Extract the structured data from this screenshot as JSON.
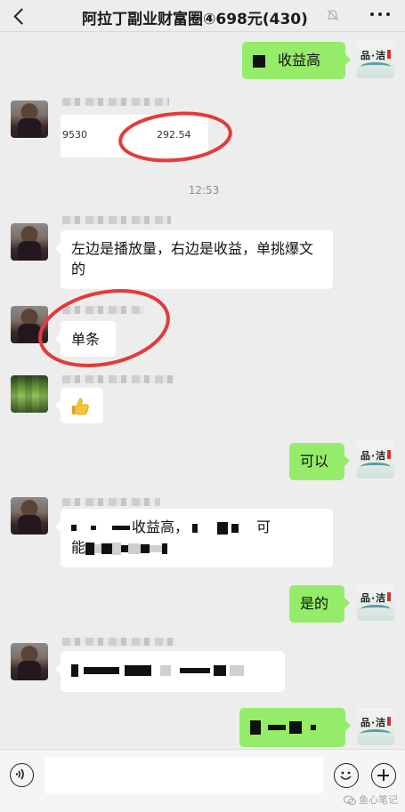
{
  "header": {
    "title": "阿拉丁副业财富圈④698元(430)",
    "back_icon": "chevron-left-icon",
    "mute_icon": "bell-off-icon",
    "more_icon": "more-dots-icon"
  },
  "timestamp": "12:53",
  "messages": [
    {
      "side": "out",
      "text": "收益高"
    },
    {
      "side": "in",
      "type": "image",
      "values": [
        "9530",
        "292.54"
      ]
    },
    {
      "side": "in",
      "text": "左边是播放量，右边是收益，单挑爆文的"
    },
    {
      "side": "in",
      "text": "单条"
    },
    {
      "side": "in",
      "type": "emoji",
      "icon": "thumbs-up-icon"
    },
    {
      "side": "out",
      "text": "可以"
    },
    {
      "side": "in",
      "text_fragments": [
        "收益高，",
        "可",
        "能"
      ]
    },
    {
      "side": "out",
      "text": "是的"
    },
    {
      "side": "in",
      "text": "(pixelated)"
    },
    {
      "side": "out",
      "text": "(pixelated)"
    }
  ],
  "input_bar": {
    "placeholder": "",
    "voice_icon": "voice-icon",
    "emoji_icon": "emoji-icon",
    "plus_icon": "plus-icon"
  },
  "watermark": "鱼心笔记",
  "colors": {
    "background": "#ededed",
    "bubble_out": "#95ec69",
    "bubble_in": "#ffffff",
    "annotation": "#e23b3b"
  }
}
